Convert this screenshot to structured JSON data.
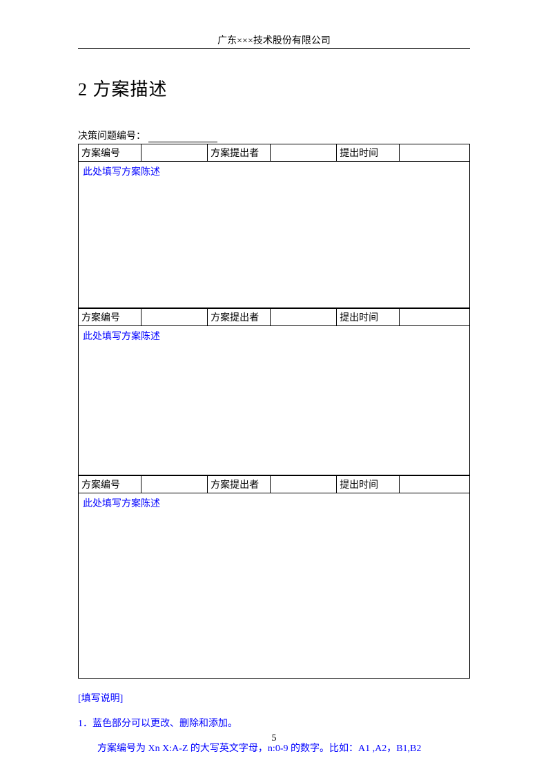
{
  "header": {
    "company": "广东×××技术股份有限公司"
  },
  "title": "2 方案描述",
  "decision_label": "决策问题编号：",
  "plan_fields": {
    "number": "方案编号",
    "proposer": "方案提出者",
    "time": "提出时间"
  },
  "plan_placeholder": "此处填写方案陈述",
  "notes": {
    "heading": "[填写说明]",
    "line1": "1．蓝色部分可以更改、删除和添加。",
    "line2": "方案编号为 Xn X:A-Z 的大写英文字母，n:0-9 的数字。比如：A1 ,A2，B1,B2"
  },
  "page_number": "5"
}
